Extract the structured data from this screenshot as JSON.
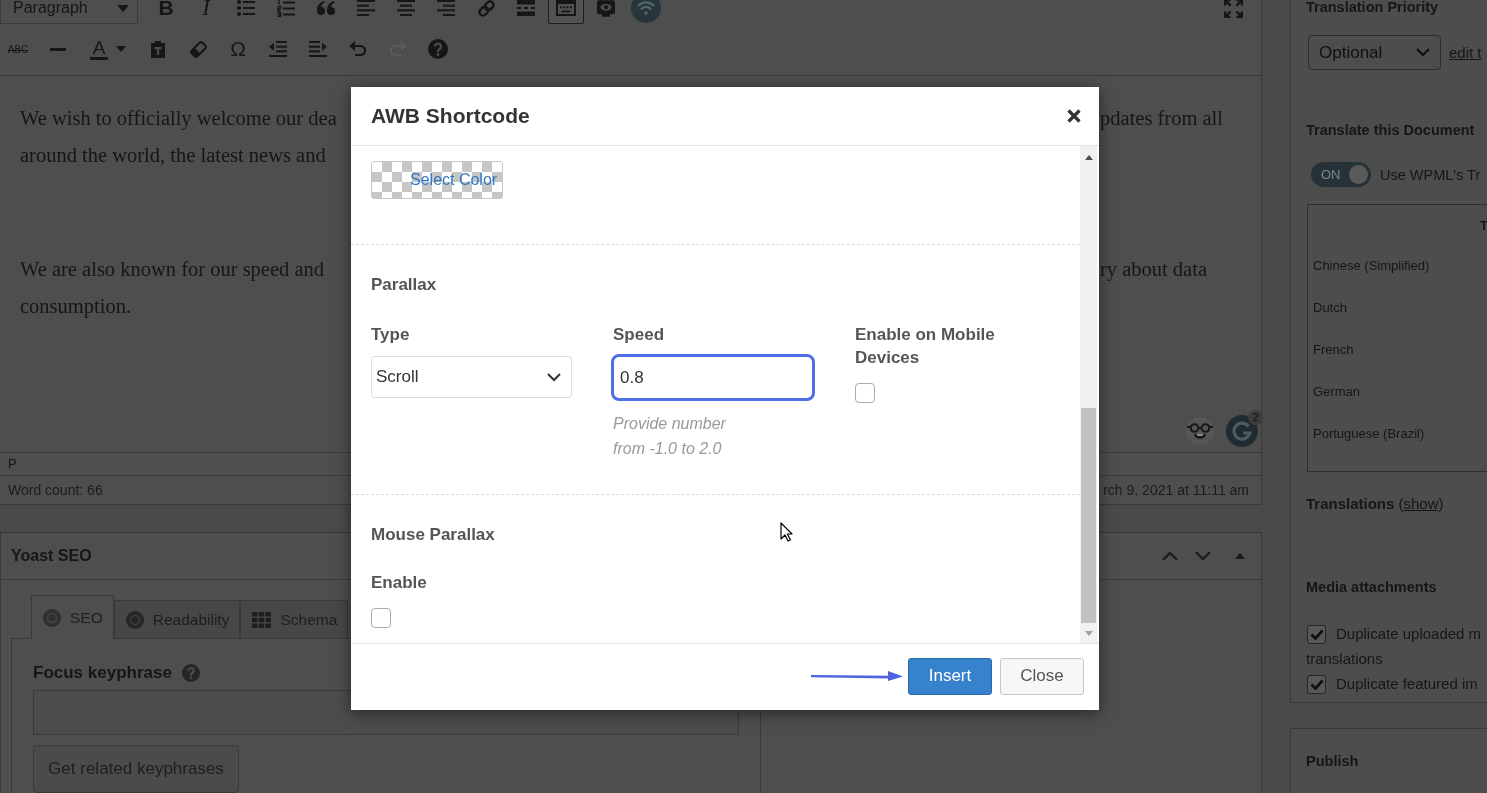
{
  "editor": {
    "toolbar": {
      "format_select": "Paragraph",
      "row_1": [
        {
          "kind": "bold",
          "label": "B",
          "pressed": false,
          "disabled": false
        },
        {
          "kind": "italic",
          "label": "I",
          "pressed": false,
          "disabled": false
        },
        {
          "kind": "icon",
          "pressed": false,
          "disabled": false
        },
        {
          "kind": "icon",
          "pressed": false,
          "disabled": false
        },
        {
          "kind": "icon",
          "pressed": false,
          "disabled": false
        },
        {
          "kind": "icon",
          "pressed": false,
          "disabled": false
        },
        {
          "kind": "icon",
          "pressed": false,
          "disabled": false
        },
        {
          "kind": "icon",
          "pressed": false,
          "disabled": false
        },
        {
          "kind": "icon",
          "pressed": false,
          "disabled": false
        },
        {
          "kind": "icon",
          "pressed": false,
          "disabled": false
        },
        {
          "kind": "icon",
          "pressed": true,
          "disabled": false
        },
        {
          "kind": "icon",
          "pressed": false,
          "disabled": false
        },
        {
          "kind": "icon",
          "pressed": false,
          "disabled": false
        }
      ],
      "row_2": [
        {
          "kind": "strike",
          "label": "ABC",
          "pressed": false,
          "disabled": false
        },
        {
          "kind": "icon",
          "pressed": false,
          "disabled": false
        },
        {
          "kind": "text-color",
          "label": "A",
          "pressed": false,
          "disabled": false
        },
        {
          "kind": "icon",
          "pressed": false,
          "disabled": false
        },
        {
          "kind": "icon",
          "pressed": false,
          "disabled": false
        },
        {
          "kind": "symbol",
          "label": "Ω",
          "pressed": false,
          "disabled": false
        },
        {
          "kind": "icon",
          "pressed": false,
          "disabled": false
        },
        {
          "kind": "icon",
          "pressed": false,
          "disabled": false
        },
        {
          "kind": "icon",
          "pressed": false,
          "disabled": false
        },
        {
          "kind": "icon",
          "pressed": false,
          "disabled": true
        },
        {
          "kind": "icon",
          "pressed": false,
          "disabled": false
        }
      ]
    },
    "paragraphs": [
      {
        "lines": [
          {
            "left": "We wish to officially welcome our dea",
            "right": "pdates from all"
          },
          {
            "left": "around the world, the latest news and"
          }
        ]
      },
      {
        "lines": [
          {
            "left": "We are also known for our speed and",
            "right": "ry about data"
          },
          {
            "left": "consumption."
          }
        ]
      }
    ],
    "grammarly_badge": "2",
    "path": "P",
    "word_count": "Word count: 66",
    "last_edited": "rch 9, 2021 at 11:11 am"
  },
  "yoast": {
    "title": "Yoast SEO",
    "tabs": [
      {
        "label": "SEO",
        "selected": true
      },
      {
        "label": "Readability",
        "selected": false
      },
      {
        "label": "Schema",
        "selected": false
      }
    ],
    "focus_keyphrase_label": "Focus keyphrase",
    "related_button": "Get related keyphrases"
  },
  "sidebar": {
    "translation_priority": {
      "heading": "Translation Priority",
      "value": "Optional",
      "link": "edit t"
    },
    "translate_document": {
      "heading": "Translate this Document",
      "toggle": {
        "label": "ON",
        "on": true
      },
      "text": "Use WPML's Tr"
    },
    "languages_table": {
      "column_2": "T",
      "rows": [
        "Chinese (Simplified)",
        "Dutch",
        "French",
        "German",
        "Portuguese (Brazil)"
      ]
    },
    "translations": {
      "label": "Translations",
      "open": "(",
      "link": "show",
      "close": ")"
    },
    "media_attachments": {
      "heading": "Media attachments",
      "options": [
        {
          "label": "Duplicate uploaded m",
          "continuation": "translations",
          "checked": true
        },
        {
          "label": "Duplicate featured im",
          "checked": true
        }
      ]
    },
    "publish": {
      "heading": "Publish"
    }
  },
  "modal": {
    "title": "AWB Shortcode",
    "color_button": "Select Color",
    "sections": [
      {
        "heading": "Parallax",
        "fields": [
          {
            "kind": "select",
            "label": "Type",
            "value": "Scroll"
          },
          {
            "kind": "input",
            "label": "Speed",
            "value": "0.8",
            "focused": true,
            "hint": "Provide number from -1.0 to 2.0"
          },
          {
            "kind": "checkbox",
            "label": "Enable on Mobile Devices",
            "checked": false
          }
        ]
      },
      {
        "heading": "Mouse Parallax",
        "fields": [
          {
            "kind": "checkbox",
            "label": "Enable",
            "checked": false
          }
        ]
      }
    ],
    "buttons": [
      {
        "kind": "primary",
        "label": "Insert"
      },
      {
        "kind": "secondary",
        "label": "Close"
      }
    ]
  }
}
